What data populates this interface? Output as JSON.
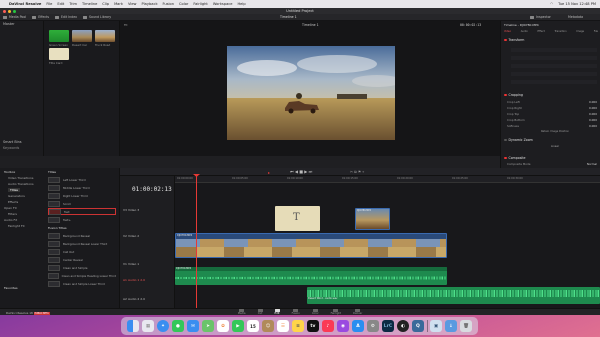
{
  "menubar": {
    "items": [
      "DaVinci Resolve",
      "File",
      "Edit",
      "Trim",
      "Timeline",
      "Clip",
      "Mark",
      "View",
      "Playback",
      "Fusion",
      "Color",
      "Fairlight",
      "Workspace",
      "Help"
    ],
    "clock": "Tue 15 Nov 12:48 PM"
  },
  "window": {
    "title": "Untitled Project",
    "toolbar": {
      "media_pool": "Media Pool",
      "effects": "Effects",
      "edit_index": "Edit Index",
      "sound_library": "Sound Library",
      "timeline_name": "Timeline 1",
      "inspector": "Inspector",
      "metadata": "Metadata"
    }
  },
  "media_pool": {
    "master_label": "Master",
    "smart_bins": "Smart Bins",
    "keywords": "Keywords",
    "clips": [
      {
        "name": "Green Screen"
      },
      {
        "name": "Desert Car"
      },
      {
        "name": "Truck Road"
      },
      {
        "name": "Title Card"
      }
    ]
  },
  "viewer": {
    "zoom": "Fit",
    "timeline_label": "Timeline 1",
    "timecode": "00:00:02:13",
    "source_timecode": "01:00:02:13"
  },
  "inspector": {
    "header": "Timeline - DJI0780.MP4",
    "tabs": [
      "Video",
      "Audio",
      "Effect",
      "Transition",
      "Image",
      "File"
    ],
    "transform_title": "Transform",
    "cropping_title": "Cropping",
    "crop_rows": [
      {
        "label": "Crop Left",
        "value": "0.000"
      },
      {
        "label": "Crop Right",
        "value": "0.000"
      },
      {
        "label": "Crop Top",
        "value": "0.000"
      },
      {
        "label": "Crop Bottom",
        "value": "0.000"
      },
      {
        "label": "Softness",
        "value": "0.000"
      }
    ],
    "retain_label": "Retain Image Position",
    "dynamic_zoom_title": "Dynamic Zoom",
    "dynamic_zoom_mode": "Linear",
    "composite_title": "Composite",
    "composite_mode_label": "Composite Mode",
    "composite_mode_value": "Normal"
  },
  "effects": {
    "categories": [
      "Toolbox",
      "Video Transitions",
      "Audio Transitions",
      "Titles",
      "Generators",
      "Effects",
      "Open FX",
      "Filters",
      "Audio FX",
      "Fairlight FX"
    ],
    "favorites": "Favorites",
    "titles_header": "Titles",
    "fusion_header": "Fusion Titles",
    "items": [
      "Left Lower Third",
      "Middle Lower Third",
      "Right Lower Third",
      "Scroll",
      "Text",
      "Text+"
    ],
    "fusion_items": [
      "Background Reveal",
      "Background Reveal Lower Third",
      "Call Out",
      "Center Reveal",
      "Clean and Simple",
      "Clean and Simple Heading Lower Third",
      "Clean and Simple Lower Third"
    ]
  },
  "timeline": {
    "timecode": "01:00:02:13",
    "ruler_ticks": [
      "01:00:00:00",
      "01:00:05:00",
      "01:00:10:00",
      "01:00:15:00",
      "01:00:20:00",
      "01:00:25:00",
      "01:00:30:00"
    ],
    "tracks": [
      {
        "id": "V3",
        "name": "Video 3"
      },
      {
        "id": "V2",
        "name": "Video 2"
      },
      {
        "id": "V1",
        "name": "Video 1"
      },
      {
        "id": "A1",
        "name": "Audio 1",
        "meta": "2.0"
      },
      {
        "id": "A2",
        "name": "Audio 2",
        "meta": "2.0"
      }
    ],
    "clips": {
      "title": "T",
      "overlay": "DJI0780.MP4",
      "video": "DJI0780.MP4",
      "audio1": "DJI0780.MP4",
      "audio2": "Desert Wind - Audio.wav"
    }
  },
  "pages": [
    {
      "label": "Media"
    },
    {
      "label": "Cut"
    },
    {
      "label": "Edit",
      "active": true
    },
    {
      "label": "Fusion"
    },
    {
      "label": "Color"
    },
    {
      "label": "Fairlight"
    },
    {
      "label": "Deliver"
    }
  ],
  "bottom": {
    "app_name": "DaVinci Resolve 18",
    "badge": "PUBLIC BETA"
  },
  "dock": {
    "apps": [
      "finder",
      "launchpad",
      "safari",
      "messages",
      "mail",
      "maps",
      "photos",
      "facetime",
      "calendar",
      "contacts",
      "reminders",
      "notes",
      "tv",
      "music",
      "podcasts",
      "app-store",
      "settings",
      "lrc",
      "davinci",
      "quicktime",
      "preview",
      "downloads",
      "trash"
    ],
    "calendar_day": "15",
    "lrc_label": "LrC"
  }
}
